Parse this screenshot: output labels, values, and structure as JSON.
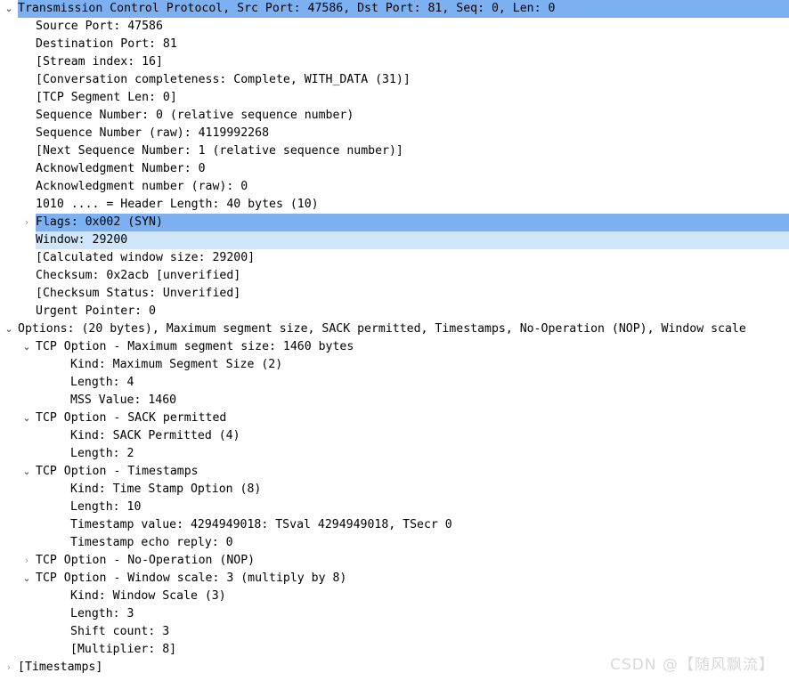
{
  "panel": {
    "name": "wireshark-packet-details",
    "colors": {
      "selection_dark": "#7db0f0",
      "selection_light": "#cfe5fa",
      "background": "#ffffff",
      "text": "#000000",
      "twisty_collapsed": "#9a9a9a",
      "twisty_expanded": "#3b3b3b",
      "watermark": "#d8d8d8"
    }
  },
  "watermark": {
    "text": "CSDN @【随风飘流】"
  },
  "icons": {
    "chevron_down": "⌄",
    "chevron_right": "›"
  },
  "tree": {
    "rows": [
      {
        "id": "tcp-root",
        "level": 0,
        "twisty": "expanded",
        "highlight": "header-selected",
        "text": "Transmission Control Protocol, Src Port: 47586, Dst Port: 81, Seq: 0, Len: 0"
      },
      {
        "id": "source-port",
        "level": 1,
        "twisty": "none",
        "highlight": "none",
        "text": "Source Port: 47586"
      },
      {
        "id": "destination-port",
        "level": 1,
        "twisty": "none",
        "highlight": "none",
        "text": "Destination Port: 81"
      },
      {
        "id": "stream-index",
        "level": 1,
        "twisty": "none",
        "highlight": "none",
        "text": "[Stream index: 16]"
      },
      {
        "id": "conversation-completeness",
        "level": 1,
        "twisty": "none",
        "highlight": "none",
        "text": "[Conversation completeness: Complete, WITH_DATA (31)]"
      },
      {
        "id": "tcp-segment-len",
        "level": 1,
        "twisty": "none",
        "highlight": "none",
        "text": "[TCP Segment Len: 0]"
      },
      {
        "id": "sequence-number",
        "level": 1,
        "twisty": "none",
        "highlight": "none",
        "text": "Sequence Number: 0    (relative sequence number)"
      },
      {
        "id": "sequence-number-raw",
        "level": 1,
        "twisty": "none",
        "highlight": "none",
        "text": "Sequence Number (raw): 4119992268"
      },
      {
        "id": "next-sequence-number",
        "level": 1,
        "twisty": "none",
        "highlight": "none",
        "text": "[Next Sequence Number: 1    (relative sequence number)]"
      },
      {
        "id": "acknowledgment-number",
        "level": 1,
        "twisty": "none",
        "highlight": "none",
        "text": "Acknowledgment Number: 0"
      },
      {
        "id": "acknowledgment-number-raw",
        "level": 1,
        "twisty": "none",
        "highlight": "none",
        "text": "Acknowledgment number (raw): 0"
      },
      {
        "id": "header-length",
        "level": 1,
        "twisty": "none",
        "highlight": "none",
        "text": "1010 .... = Header Length: 40 bytes (10)"
      },
      {
        "id": "flags",
        "level": 1,
        "twisty": "collapsed",
        "highlight": "dark",
        "text": "Flags: 0x002 (SYN)"
      },
      {
        "id": "window",
        "level": 1,
        "twisty": "none",
        "highlight": "light",
        "text": "Window: 29200"
      },
      {
        "id": "calculated-window-size",
        "level": 1,
        "twisty": "none",
        "highlight": "none",
        "text": "[Calculated window size: 29200]"
      },
      {
        "id": "checksum",
        "level": 1,
        "twisty": "none",
        "highlight": "none",
        "text": "Checksum: 0x2acb [unverified]"
      },
      {
        "id": "checksum-status",
        "level": 1,
        "twisty": "none",
        "highlight": "none",
        "text": "[Checksum Status: Unverified]"
      },
      {
        "id": "urgent-pointer",
        "level": 1,
        "twisty": "none",
        "highlight": "none",
        "text": "Urgent Pointer: 0"
      },
      {
        "id": "options",
        "level": 0,
        "twisty": "expanded",
        "highlight": "none",
        "text": "Options: (20 bytes), Maximum segment size, SACK permitted, Timestamps, No-Operation (NOP), Window scale"
      },
      {
        "id": "option-mss",
        "level": 1,
        "twisty": "expanded",
        "highlight": "none",
        "text": "TCP Option - Maximum segment size: 1460 bytes"
      },
      {
        "id": "option-mss-kind",
        "level": 3,
        "twisty": "none",
        "highlight": "none",
        "text": "Kind: Maximum Segment Size (2)"
      },
      {
        "id": "option-mss-length",
        "level": 3,
        "twisty": "none",
        "highlight": "none",
        "text": "Length: 4"
      },
      {
        "id": "option-mss-value",
        "level": 3,
        "twisty": "none",
        "highlight": "none",
        "text": "MSS Value: 1460"
      },
      {
        "id": "option-sack-permitted",
        "level": 1,
        "twisty": "expanded",
        "highlight": "none",
        "text": "TCP Option - SACK permitted"
      },
      {
        "id": "option-sack-kind",
        "level": 3,
        "twisty": "none",
        "highlight": "none",
        "text": "Kind: SACK Permitted (4)"
      },
      {
        "id": "option-sack-length",
        "level": 3,
        "twisty": "none",
        "highlight": "none",
        "text": "Length: 2"
      },
      {
        "id": "option-timestamps",
        "level": 1,
        "twisty": "expanded",
        "highlight": "none",
        "text": "TCP Option - Timestamps"
      },
      {
        "id": "option-timestamps-kind",
        "level": 3,
        "twisty": "none",
        "highlight": "none",
        "text": "Kind: Time Stamp Option (8)"
      },
      {
        "id": "option-timestamps-length",
        "level": 3,
        "twisty": "none",
        "highlight": "none",
        "text": "Length: 10"
      },
      {
        "id": "option-timestamp-value",
        "level": 3,
        "twisty": "none",
        "highlight": "none",
        "text": "Timestamp value: 4294949018: TSval 4294949018, TSecr 0"
      },
      {
        "id": "option-timestamp-echo-reply",
        "level": 3,
        "twisty": "none",
        "highlight": "none",
        "text": "Timestamp echo reply: 0"
      },
      {
        "id": "option-nop",
        "level": 1,
        "twisty": "collapsed",
        "highlight": "none",
        "text": "TCP Option - No-Operation (NOP)"
      },
      {
        "id": "option-window-scale",
        "level": 1,
        "twisty": "expanded",
        "highlight": "none",
        "text": "TCP Option - Window scale: 3 (multiply by 8)"
      },
      {
        "id": "option-window-scale-kind",
        "level": 3,
        "twisty": "none",
        "highlight": "none",
        "text": "Kind: Window Scale (3)"
      },
      {
        "id": "option-window-scale-length",
        "level": 3,
        "twisty": "none",
        "highlight": "none",
        "text": "Length: 3"
      },
      {
        "id": "option-window-scale-shift-count",
        "level": 3,
        "twisty": "none",
        "highlight": "none",
        "text": "Shift count: 3"
      },
      {
        "id": "option-window-scale-multiplier",
        "level": 3,
        "twisty": "none",
        "highlight": "none",
        "text": "[Multiplier: 8]"
      },
      {
        "id": "timestamps",
        "level": 0,
        "twisty": "collapsed",
        "highlight": "none",
        "text": "[Timestamps]"
      }
    ]
  }
}
